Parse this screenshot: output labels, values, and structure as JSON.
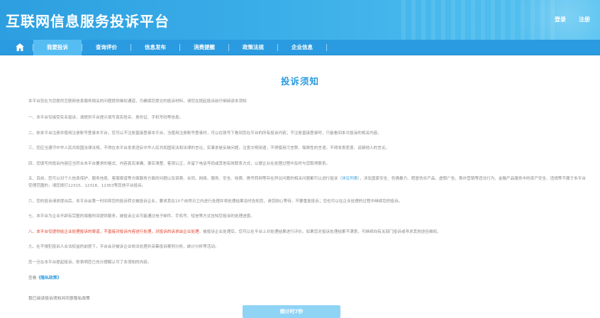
{
  "header": {
    "site_title": "互联网信息服务投诉平台",
    "login_label": "登录",
    "register_label": "注册"
  },
  "nav": {
    "home_icon": "home-icon",
    "items": [
      {
        "label": "我要投诉",
        "active": true
      },
      {
        "label": "查询评价"
      },
      {
        "label": "信息发布"
      },
      {
        "label": "消费提醒"
      },
      {
        "label": "政策法规"
      },
      {
        "label": "企业信息"
      }
    ]
  },
  "main": {
    "title": "投诉须知",
    "paragraphs": [
      "本平台旨在为您提供互联网信息服务相关的问题提供维权通道，为确保您提交的投诉材料，请您在提起投诉前仔细阅读本须知",
      "一、本平台仅接受实名投诉，请提供平台提示填写真实姓名、身份证、手机号码等信息。",
      "二、依本平台注册并使用注册账号登录本平台，您可以不注册直接登录本平台，当使用注册账号登录时，可以在账号下看到您在平台的所有投诉内容；不注册直接登录时，只能看到本次投诉的相关内容。",
      "三、您应当遵守中华人民共和国法律法规，不得在本平台发表违反中华人民共和国宪法和法律的言论，实事求是反映问题，注意文明用语，不得使用污言秽、侮辱性的言语，不得发表恶意、诋毁他人的言论。",
      "四、您填写的投诉内容应当符合本平台要求的格式、内容真实准确、事实清楚、客观公正，并留下电话号码或其他有效联系方式，以便企业在处理过程中及时与您取得联系。",
      "六、您的投诉请求提出后，本平台会第一时间将您的投诉转交被投诉企业，要求其在15个自然日之内进行处理并将处理结果及时告知您，请您耐心等待，不要重复投诉；您也可以在企业处理的过程中继续您的投诉。",
      "七、本平台为企业开辟有完整的填报时间提供服务，被投诉企业可能通过电子邮件、手机号、短信等方式告知您投诉的处理进度。",
      "九、在不侵犯投诉人合法权益的前提下，平台会对被诉企业依法处理并采集投诉案例分析，统计分析等活动。",
      "您一旦在本平台提起投诉，即表明您已充分理解认可了本须知的内容。"
    ],
    "para5": {
      "before": "五、目前，您可以对个人信息保护、服务信息、客服渠道等方面服务方面的问题以及资费、合同、网络、服务、安全、收费、携号转网等存在异议问题的相关问题都可以进行投诉（",
      "link": "详见列表",
      "after": "），涉及国家安全、色情暴力、假冒伪劣产品、虚假广告、欺诈营销等违法行为、金融产品服务中的资产安全、违规等不属于本平台受理范围的，请您拨打12315、12318、12363等其他平台投诉。"
    },
    "para8": {
      "red": "八、本平台仅提供给企业处理投诉的渠道，不直接对投诉内容进行处理，对投诉的诉求由企业处理",
      "after": "，被投诉企业处理后，您可以在平台上对处理结果进行评价。如果您对投诉处理结果不满意，可继续向有关部门投诉或寻求其他途径维权。"
    },
    "privacy_note_prefix": "查看",
    "privacy_note_link": "《隐私政策》",
    "agree_text": "我已阅读投诉须知并同意隐私政策",
    "countdown_button": "倒计时7秒"
  },
  "colors": {
    "brand_blue": "#2a9be0",
    "active_tab": "#56bdf3",
    "warning_red": "#e0402a",
    "disabled_button": "#8fd3f5"
  }
}
